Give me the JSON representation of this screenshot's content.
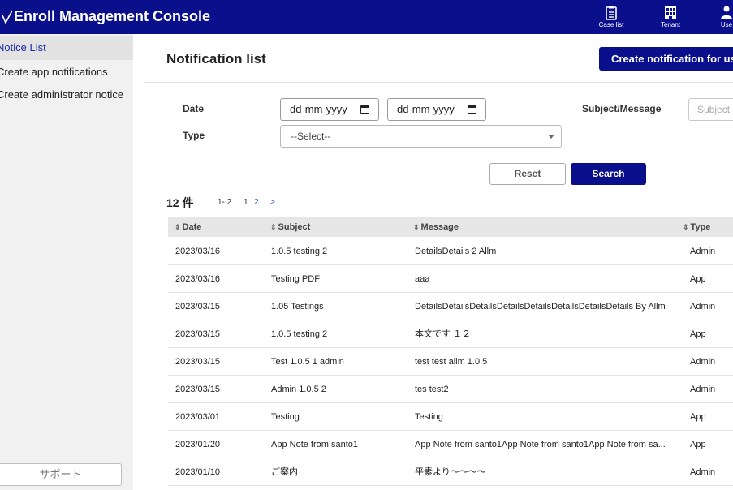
{
  "header": {
    "app_title": "Enroll Management Console",
    "nav": [
      {
        "label": "Case list",
        "icon": "clipboard-icon"
      },
      {
        "label": "Tenant",
        "icon": "building-icon"
      },
      {
        "label": "Use",
        "icon": "user-icon"
      }
    ]
  },
  "sidebar": {
    "items": [
      {
        "label": "Notice List",
        "active": true
      },
      {
        "label": "Create app notifications",
        "active": false
      },
      {
        "label": "Create administrator notice",
        "active": false
      }
    ],
    "support_label": "サポート"
  },
  "main": {
    "title": "Notification list",
    "create_button": "Create notification for us"
  },
  "filters": {
    "date_label": "Date",
    "date_from": "dd-mm-yyyy",
    "date_separator": "-",
    "date_to": "dd-mm-yyyy",
    "subject_label": "Subject/Message",
    "subject_placeholder": "Subject",
    "type_label": "Type",
    "type_selected": "--Select--",
    "reset_label": "Reset",
    "search_label": "Search"
  },
  "results": {
    "count": "12 件",
    "range": "1- 2",
    "pages": [
      "1",
      "2",
      ">"
    ]
  },
  "table": {
    "columns": [
      "Date",
      "Subject",
      "Message",
      "Type"
    ],
    "rows": [
      [
        "2023/03/16",
        "1.0.5 testing 2",
        "DetailsDetails 2 Allm",
        "Admin"
      ],
      [
        "2023/03/16",
        "Testing PDF",
        "aaa",
        "App"
      ],
      [
        "2023/03/15",
        "1.05 Testings",
        "DetailsDetailsDetailsDetailsDetailsDetailsDetailsDetails By Allm",
        "Admin"
      ],
      [
        "2023/03/15",
        "1.0.5 testing 2",
        "本文です １２",
        "App"
      ],
      [
        "2023/03/15",
        "Test 1.0.5 1 admin",
        "test test allm 1.0.5",
        "Admin"
      ],
      [
        "2023/03/15",
        "Admin 1.0.5 2",
        "tes test2",
        "Admin"
      ],
      [
        "2023/03/01",
        "Testing",
        "Testing",
        "App"
      ],
      [
        "2023/01/20",
        "App Note from santo1",
        "App Note from santo1App Note from santo1App Note from sa...",
        "App"
      ],
      [
        "2023/01/10",
        "ご案内",
        "平素より〜〜〜〜",
        "Admin"
      ]
    ]
  },
  "colors": {
    "primary": "#0a0f8c",
    "link": "#1a55d0",
    "sidebar_bg": "#f1f1f1",
    "table_header_bg": "#e6e6e6"
  }
}
